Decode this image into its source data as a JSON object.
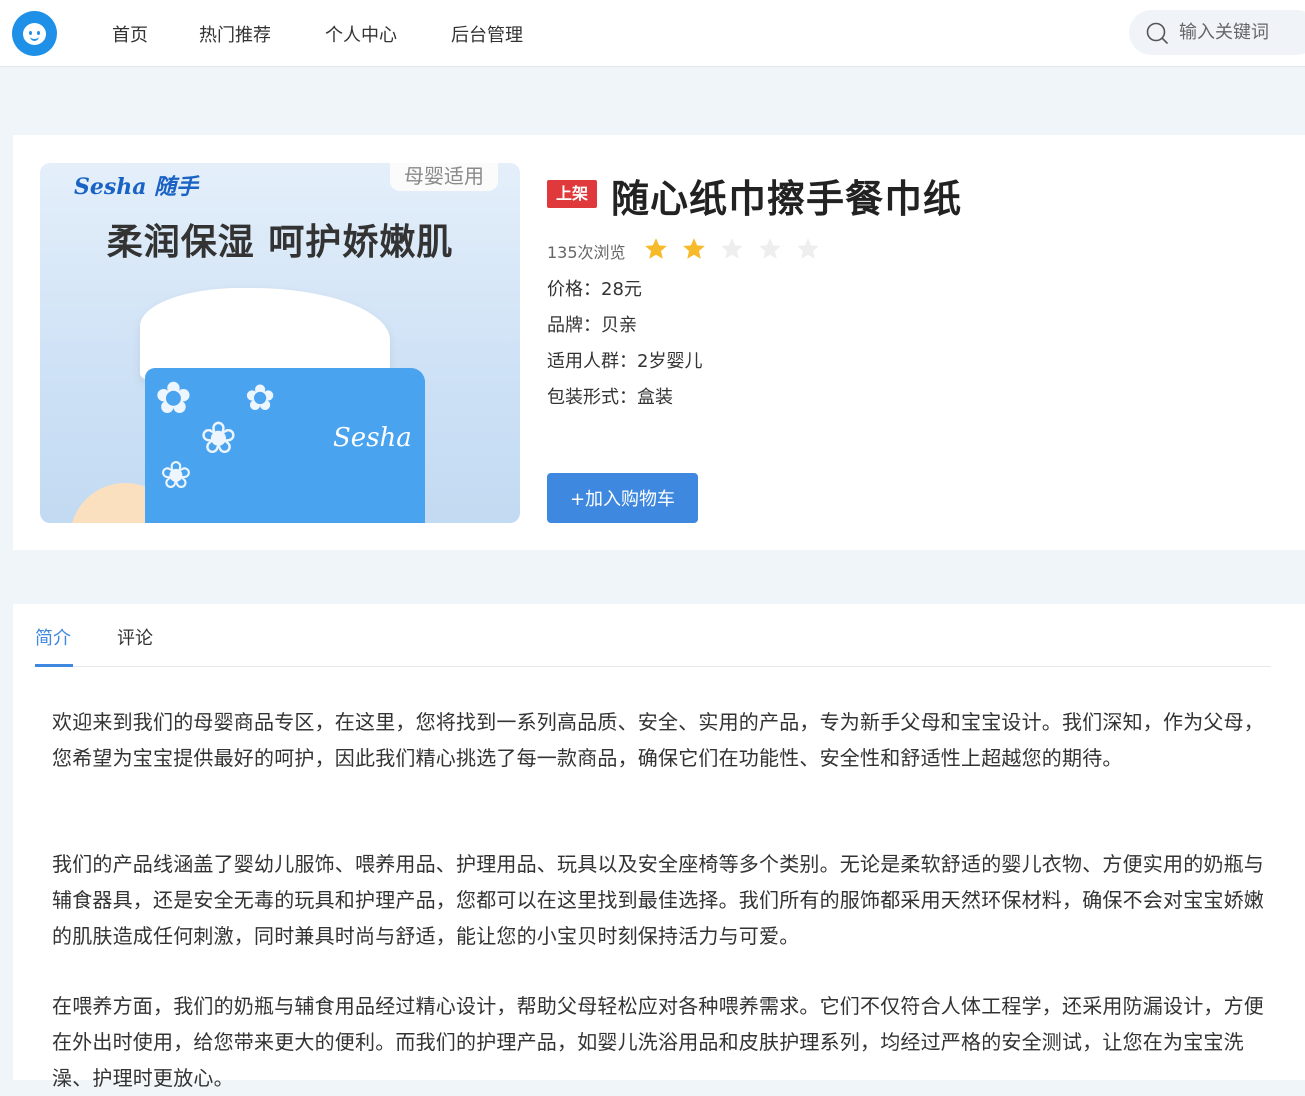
{
  "header": {
    "nav": [
      "首页",
      "热门推荐",
      "个人中心",
      "后台管理"
    ],
    "search_placeholder": "输入关键词"
  },
  "product": {
    "status": "上架",
    "title": "随心纸巾擦手餐巾纸",
    "views": "135次浏览",
    "rating": 2,
    "rating_max": 5,
    "star_color": "#f7ba2a",
    "star_empty_color": "#eeeeee",
    "attributes": [
      {
        "label": "价格：",
        "value": "28元"
      },
      {
        "label": "品牌：",
        "value": "贝亲"
      },
      {
        "label": "适用人群：",
        "value": "2岁婴儿"
      },
      {
        "label": "包装形式：",
        "value": "盒装"
      }
    ],
    "add_to_cart": "+加入购物车",
    "image": {
      "brand": "Sesha 随手",
      "badge": "母婴适用",
      "slogan": "柔润保湿 呵护娇嫩肌",
      "box_brand": "Sesha"
    }
  },
  "detail": {
    "tabs": [
      "简介",
      "评论"
    ],
    "active_tab": "简介",
    "paragraphs": [
      "欢迎来到我们的母婴商品专区，在这里，您将找到一系列高品质、安全、实用的产品，专为新手父母和宝宝设计。我们深知，作为父母，您希望为宝宝提供最好的呵护，因此我们精心挑选了每一款商品，确保它们在功能性、安全性和舒适性上超越您的期待。",
      "我们的产品线涵盖了婴幼儿服饰、喂养用品、护理用品、玩具以及安全座椅等多个类别。无论是柔软舒适的婴儿衣物、方便实用的奶瓶与辅食器具，还是安全无毒的玩具和护理产品，您都可以在这里找到最佳选择。我们所有的服饰都采用天然环保材料，确保不会对宝宝娇嫩的肌肤造成任何刺激，同时兼具时尚与舒适，能让您的小宝贝时刻保持活力与可爱。",
      "在喂养方面，我们的奶瓶与辅食用品经过精心设计，帮助父母轻松应对各种喂养需求。它们不仅符合人体工程学，还采用防漏设计，方便在外出时使用，给您带来更大的便利。而我们的护理产品，如婴儿洗浴用品和皮肤护理系列，均经过严格的安全测试，让您在为宝宝洗澡、护理时更放心。"
    ]
  },
  "colors": {
    "primary": "#3f88e0",
    "status_tag": "#e0393b",
    "logo": "#1e90e8"
  }
}
